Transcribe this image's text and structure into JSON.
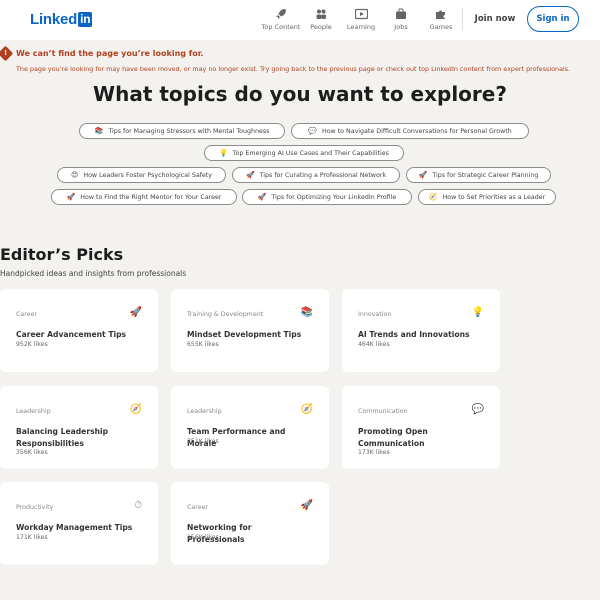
{
  "header": {
    "logo_text": "Linked",
    "logo_box": "in",
    "nav": [
      {
        "label": "Top Content",
        "icon": "rocket-icon"
      },
      {
        "label": "People",
        "icon": "people-icon"
      },
      {
        "label": "Learning",
        "icon": "video-icon"
      },
      {
        "label": "Jobs",
        "icon": "briefcase-icon"
      },
      {
        "label": "Games",
        "icon": "puzzle-icon"
      }
    ],
    "join_label": "Join now",
    "signin_label": "Sign in"
  },
  "error": {
    "title": "We can’t find the page you’re looking for.",
    "description": "The page you’re looking for may have been moved, or may no longer exist. Try going back to the previous page or check out top LinkedIn content from expert professionals."
  },
  "hero_title": "What topics do you want to explore?",
  "topics": [
    {
      "label": "Tips for Managing Stressors with Mental Toughness",
      "icon": "📚"
    },
    {
      "label": "How to Navigate Difficult Conversations for Personal Growth",
      "icon": "💬"
    },
    {
      "label": "Top Emerging AI Use Cases and Their Capabilities",
      "icon": "💡"
    },
    {
      "label": "How Leaders Foster Psychological Safety",
      "icon": "😊"
    },
    {
      "label": "Tips for Curating a Professional Network",
      "icon": "🚀"
    },
    {
      "label": "Tips for Strategic Career Planning",
      "icon": "🚀"
    },
    {
      "label": "How to Find the Right Mentor for Your Career",
      "icon": "🚀"
    },
    {
      "label": "Tips for Optimizing Your LinkedIn Profile",
      "icon": "🚀"
    },
    {
      "label": "How to Set Priorities as a Leader",
      "icon": "🧭"
    }
  ],
  "picks": {
    "title": "Editor’s Picks",
    "subtitle": "Handpicked ideas and insights from professionals",
    "cards": [
      {
        "category": "Career",
        "icon": "🚀",
        "title": "Career Advancement Tips",
        "likes": "952K likes"
      },
      {
        "category": "Training & Development",
        "icon": "📚",
        "title": "Mindset Development Tips",
        "likes": "655K likes"
      },
      {
        "category": "Innovation",
        "icon": "💡",
        "title": "AI Trends and Innovations",
        "likes": "464K likes"
      },
      {
        "category": "Leadership",
        "icon": "🧭",
        "title": "Balancing Leadership Responsibilities",
        "likes": "356K likes"
      },
      {
        "category": "Leadership",
        "icon": "🧭",
        "title": "Team Performance and Morale",
        "likes": "251K likes"
      },
      {
        "category": "Communication",
        "icon": "💬",
        "title": "Promoting Open Communication",
        "likes": "173K likes"
      },
      {
        "category": "Productivity",
        "icon": "⏱",
        "title": "Workday Management Tips",
        "likes": "171K likes"
      },
      {
        "category": "Career",
        "icon": "🚀",
        "title": "Networking for Professionals",
        "likes": "156K likes"
      }
    ]
  },
  "colors": {
    "brand": "#0a66c2",
    "error": "#b24020",
    "background": "#f3f2ef"
  }
}
